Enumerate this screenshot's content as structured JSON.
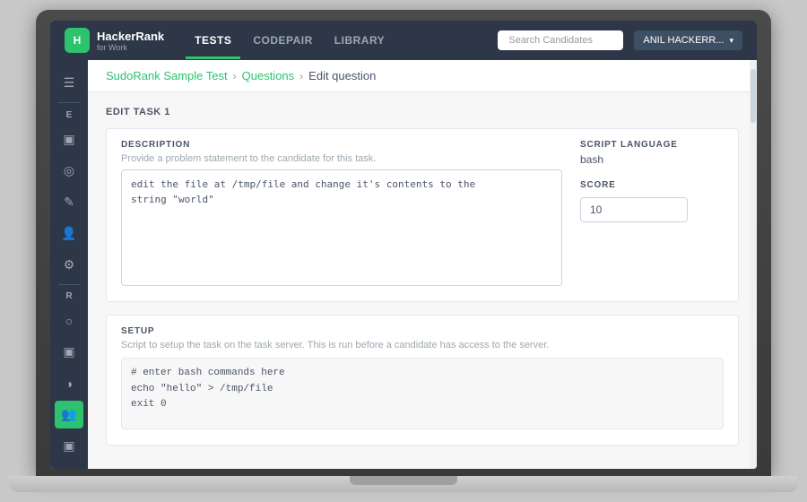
{
  "nav": {
    "brand_letter": "H",
    "brand_name": "HackerRank",
    "brand_sub": "for Work",
    "links": [
      {
        "label": "TESTS",
        "active": true
      },
      {
        "label": "CODEPAIR",
        "active": false
      },
      {
        "label": "LIBRARY",
        "active": false
      }
    ],
    "search_placeholder": "Search Candidates",
    "user_label": "ANIL HACKERR...",
    "chevron": "▾"
  },
  "sidebar": {
    "icons": [
      {
        "symbol": "☰",
        "label": "menu-icon"
      },
      {
        "symbol": "E",
        "letter": true
      },
      {
        "symbol": "▣",
        "label": "grid-icon"
      },
      {
        "symbol": "⊙",
        "label": "circle-icon"
      },
      {
        "symbol": "✎",
        "label": "edit-icon"
      },
      {
        "symbol": "👤",
        "label": "user-icon"
      },
      {
        "symbol": "⚙",
        "label": "gear-icon"
      },
      {
        "symbol": "R",
        "letter": true
      },
      {
        "symbol": "○",
        "label": "ring-icon"
      },
      {
        "symbol": "▣",
        "label": "grid2-icon"
      },
      {
        "symbol": "◑",
        "label": "half-circle-icon"
      },
      {
        "symbol": "👥",
        "label": "users-icon",
        "active": true
      },
      {
        "symbol": "▣",
        "label": "grid3-icon"
      }
    ]
  },
  "breadcrumb": {
    "items": [
      {
        "label": "SudoRank Sample Test",
        "link": true
      },
      {
        "label": "Questions",
        "link": true
      },
      {
        "label": "Edit question",
        "link": false
      }
    ]
  },
  "task": {
    "section_label": "EDIT TASK 1",
    "description": {
      "label": "DESCRIPTION",
      "hint": "Provide a problem statement to the candidate for this task.",
      "value": "edit the file at /tmp/file and change it's contents to the\nstring \"world\""
    },
    "script_language": {
      "label": "SCRIPT LANGUAGE",
      "value": "bash"
    },
    "score": {
      "label": "SCORE",
      "value": "10"
    },
    "setup": {
      "label": "SETUP",
      "hint": "Script to setup the task on the task server. This is run before a candidate has access\nto the server.",
      "value": "# enter bash commands here\necho \"hello\" > /tmp/file\nexit 0"
    }
  }
}
